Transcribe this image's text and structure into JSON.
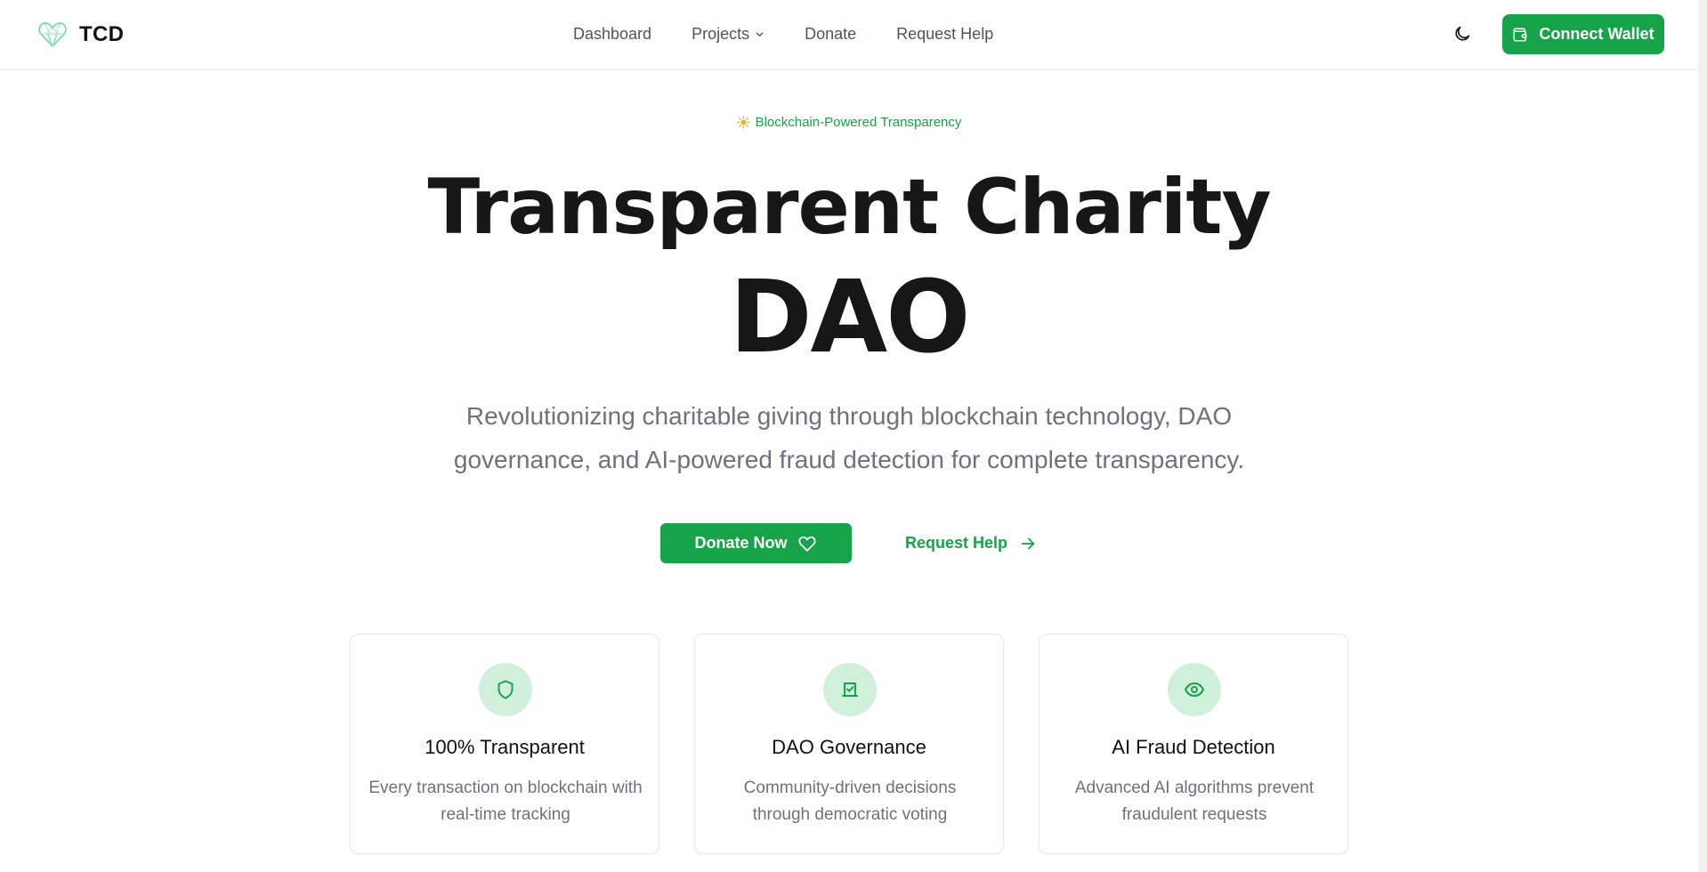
{
  "brand": {
    "name": "TCD",
    "logo_icon": "heart-logo-icon",
    "accent": "#16a34a"
  },
  "nav": {
    "items": [
      {
        "label": "Dashboard",
        "has_dropdown": false
      },
      {
        "label": "Projects",
        "has_dropdown": true
      },
      {
        "label": "Donate",
        "has_dropdown": false
      },
      {
        "label": "Request Help",
        "has_dropdown": false
      }
    ]
  },
  "header": {
    "theme_toggle_icon": "moon-icon",
    "connect_label": "Connect Wallet",
    "connect_icon": "wallet-icon"
  },
  "hero": {
    "badge_icon": "sparkle-icon",
    "badge": "Blockchain-Powered Transparency",
    "title_line1": "Transparent Charity",
    "title_line2": "DAO",
    "subtitle": "Revolutionizing charitable giving through blockchain technology, DAO governance, and AI-powered fraud detection for complete transparency.",
    "primary_cta": "Donate Now",
    "primary_cta_icon": "heart-icon",
    "secondary_cta": "Request Help",
    "secondary_cta_icon": "arrow-right-icon"
  },
  "features": [
    {
      "icon": "shield-icon",
      "title": "100% Transparent",
      "description": "Every transaction on blockchain with real-time tracking"
    },
    {
      "icon": "vote-icon",
      "title": "DAO Governance",
      "description": "Community-driven decisions through democratic voting"
    },
    {
      "icon": "eye-icon",
      "title": "AI Fraud Detection",
      "description": "Advanced AI algorithms prevent fraudulent requests"
    }
  ]
}
